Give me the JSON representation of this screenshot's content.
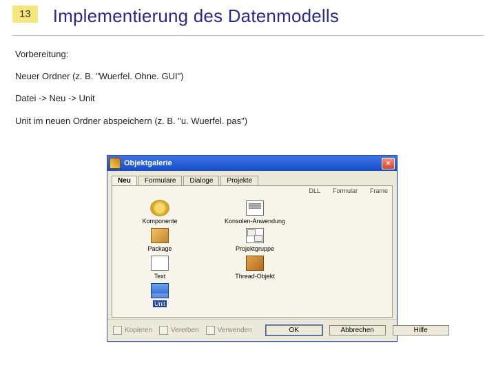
{
  "slide": {
    "number": "13",
    "title": "Implementierung des Datenmodells"
  },
  "body": {
    "p1": "Vorbereitung:",
    "p2": "Neuer Ordner (z. B. \"Wuerfel. Ohne. GUI\")",
    "p3": "Datei -> Neu -> Unit",
    "p4": "Unit im neuen Ordner abspeichern (z. B. \"u. Wuerfel. pas\")"
  },
  "dialog": {
    "title": "Objektgalerie",
    "close": "×",
    "tabs": [
      "Neu",
      "Formulare",
      "Dialoge",
      "Projekte"
    ],
    "activeTab": 0,
    "headerRight": [
      "DLL",
      "Formular",
      "Frame"
    ],
    "items": [
      {
        "label": "Komponente",
        "icon": "ico-gear",
        "selected": false
      },
      {
        "label": "Konsolen-Anwendung",
        "icon": "ico-doc",
        "selected": false
      },
      {
        "label": "Package",
        "icon": "ico-pack",
        "selected": false
      },
      {
        "label": "Projektgruppe",
        "icon": "ico-grp",
        "selected": false
      },
      {
        "label": "Text",
        "icon": "ico-text",
        "selected": false
      },
      {
        "label": "Thread-Objekt",
        "icon": "ico-thread",
        "selected": false
      },
      {
        "label": "Unit",
        "icon": "ico-unit",
        "selected": true
      }
    ],
    "checks": {
      "copy": "Kopieren",
      "inherit": "Vererben",
      "use": "Verwenden"
    },
    "buttons": {
      "ok": "OK",
      "cancel": "Abbrechen",
      "help": "Hilfe"
    }
  }
}
